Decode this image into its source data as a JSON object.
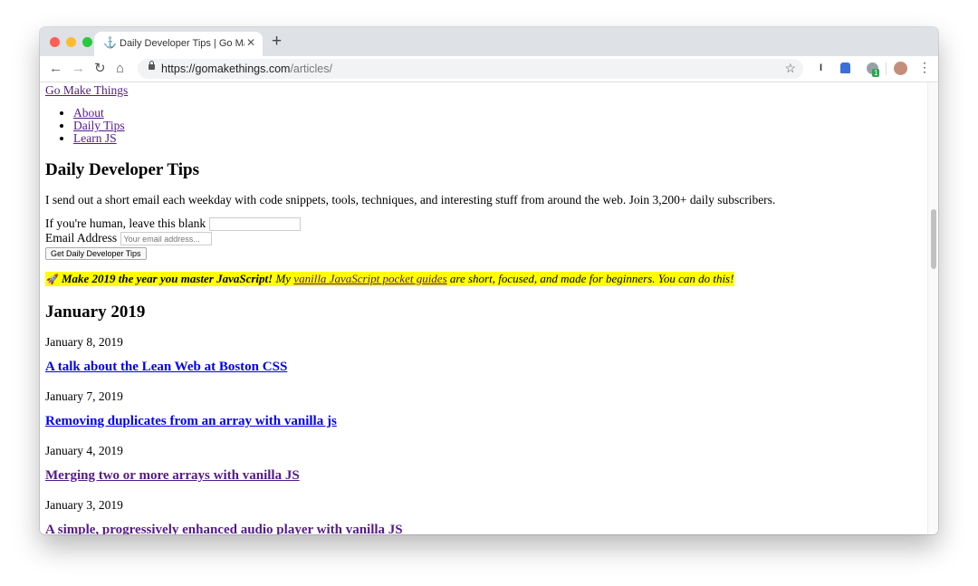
{
  "browser": {
    "tab_title": "Daily Developer Tips | Go Make Things",
    "url_host": "https://gomakethings.com",
    "url_path": "/articles/",
    "extension_badge_count": "1"
  },
  "site": {
    "name": "Go Make Things",
    "nav": [
      "About",
      "Daily Tips",
      "Learn JS"
    ]
  },
  "page": {
    "title": "Daily Developer Tips",
    "intro": "I send out a short email each weekday with code snippets, tools, techniques, and interesting stuff from around the web. Join 3,200+ daily subscribers.",
    "form": {
      "honeypot_label": "If you're human, leave this blank",
      "email_label": "Email Address",
      "email_placeholder": "Your email address...",
      "submit_label": "Get Daily Developer Tips"
    },
    "promo": {
      "bold": "Make 2019 the year you master JavaScript!",
      "pre": "My",
      "link": "vanilla JavaScript pocket guides",
      "post": "are short, focused, and made for beginners. You can do this!"
    },
    "month": "January 2019",
    "articles": [
      {
        "date": "January 8, 2019",
        "title": "A talk about the Lean Web at Boston CSS"
      },
      {
        "date": "January 7, 2019",
        "title": "Removing duplicates from an array with vanilla js"
      },
      {
        "date": "January 4, 2019",
        "title": "Merging two or more arrays with vanilla JS"
      },
      {
        "date": "January 3, 2019",
        "title": "A simple, progressively enhanced audio player with vanilla JS"
      }
    ]
  }
}
